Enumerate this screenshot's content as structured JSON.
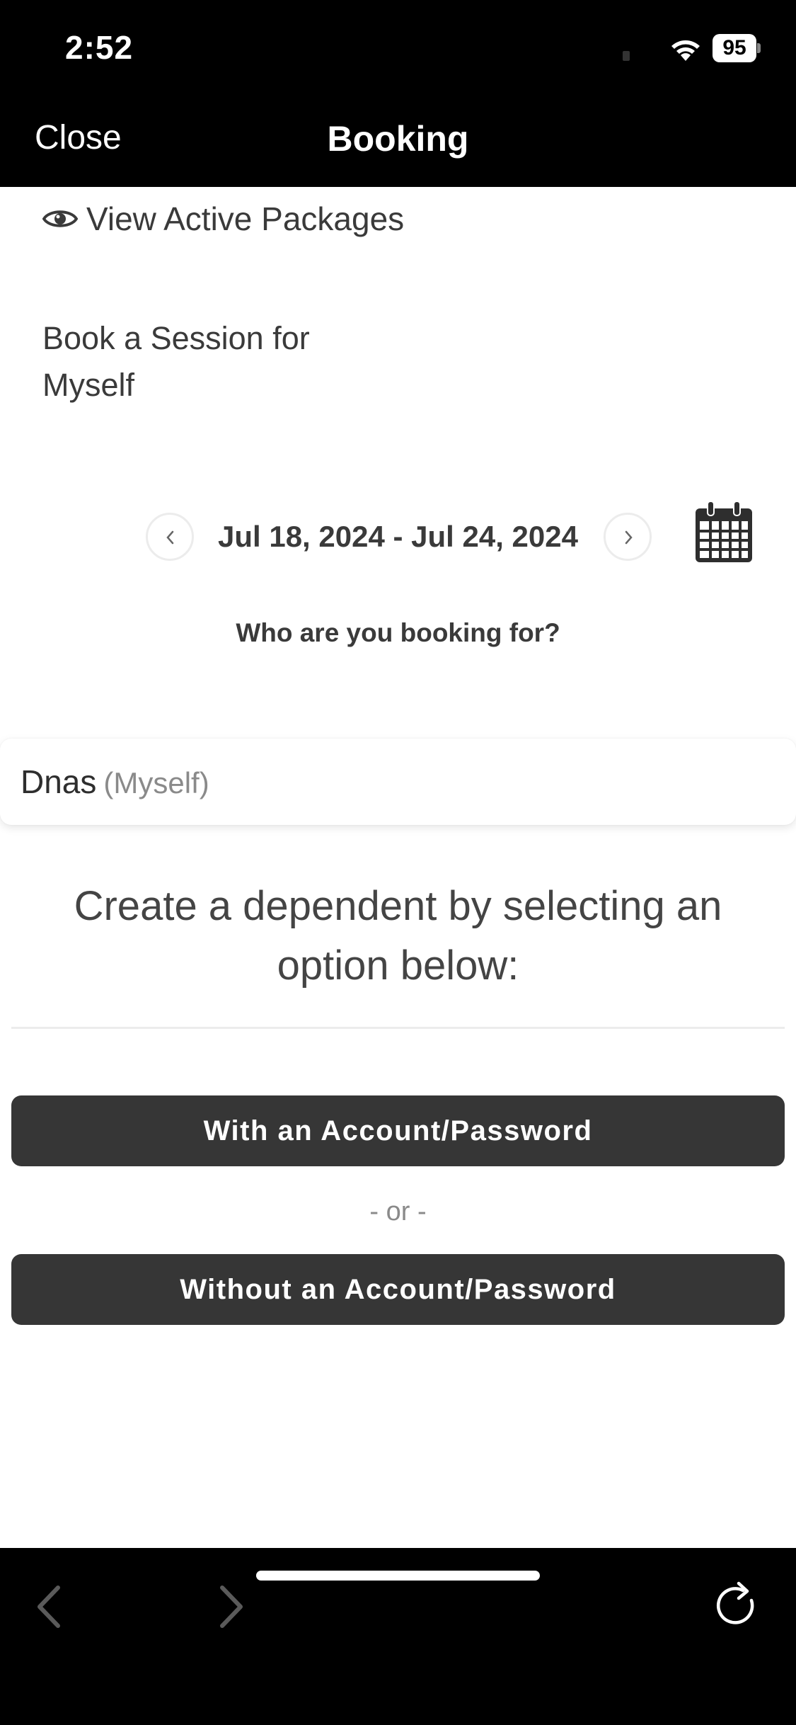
{
  "status_bar": {
    "time": "2:52",
    "battery": "95"
  },
  "nav": {
    "close_label": "Close",
    "title": "Booking"
  },
  "content": {
    "view_packages_label": "View Active Packages",
    "book_session_label": "Book a Session for Myself",
    "date_range": "Jul 18, 2024 - Jul 24, 2024",
    "who_label": "Who are you booking for?",
    "person": {
      "name": "Dnas",
      "tag": "(Myself)"
    },
    "create_dependent_text": "Create a dependent by selecting an option below:",
    "with_account_button": "With an Account/Password",
    "or_separator": "- or -",
    "without_account_button": "Without an Account/Password"
  },
  "icons": {
    "view_packages": "eye-icon",
    "date_prev": "chevron-left-icon",
    "date_next": "chevron-right-icon",
    "calendar": "calendar-icon",
    "toolbar_back": "back-arrow-icon",
    "toolbar_forward": "forward-arrow-icon",
    "toolbar_reload": "reload-icon"
  },
  "colors": {
    "bar_background": "#000000",
    "button_background": "#363636",
    "text": "#3a3a3a",
    "muted_text": "#8a8a8a"
  }
}
